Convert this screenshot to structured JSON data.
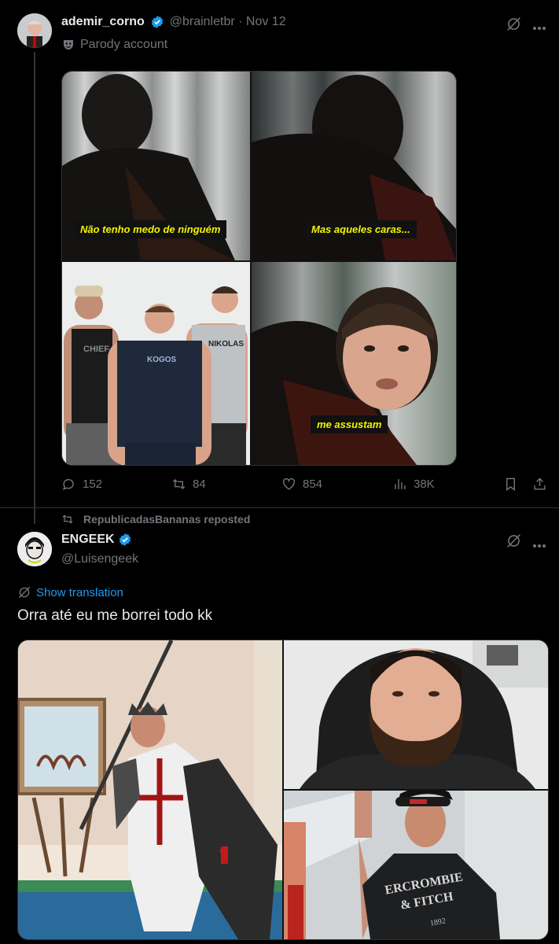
{
  "post1": {
    "display_name": "ademir_corno",
    "handle": "@brainletbr",
    "separator": "·",
    "date": "Nov 12",
    "label": "Parody account",
    "captions": [
      "Não tenho medo de ninguém",
      "Mas aqueles caras...",
      "me assustam"
    ],
    "shirt_labels": [
      "CHIEF",
      "KOGOS",
      "NIKOLAS"
    ],
    "actions": {
      "replies": "152",
      "reposts": "84",
      "likes": "854",
      "views": "38K"
    }
  },
  "repost_banner": "RepublicadasBananas reposted",
  "post2": {
    "display_name": "ENGEEK",
    "handle": "@Luisengeek",
    "translation_link": "Show translation",
    "text": "Orra até eu me borrei todo kk",
    "shirt_text": [
      "ERCROMBIE",
      "& FITCH",
      "1892"
    ]
  },
  "colors": {
    "background": "#000000",
    "text": "#e7e9ea",
    "muted": "#71767b",
    "link": "#1d9bf0",
    "verified": "#1d9bf0",
    "caption_text": "#f4f400"
  },
  "icons": [
    "verified-badge-icon",
    "parody-mask-icon",
    "grok-icon",
    "more-icon",
    "reply-icon",
    "repost-icon",
    "like-icon",
    "views-icon",
    "bookmark-icon",
    "share-icon",
    "translate-icon"
  ]
}
